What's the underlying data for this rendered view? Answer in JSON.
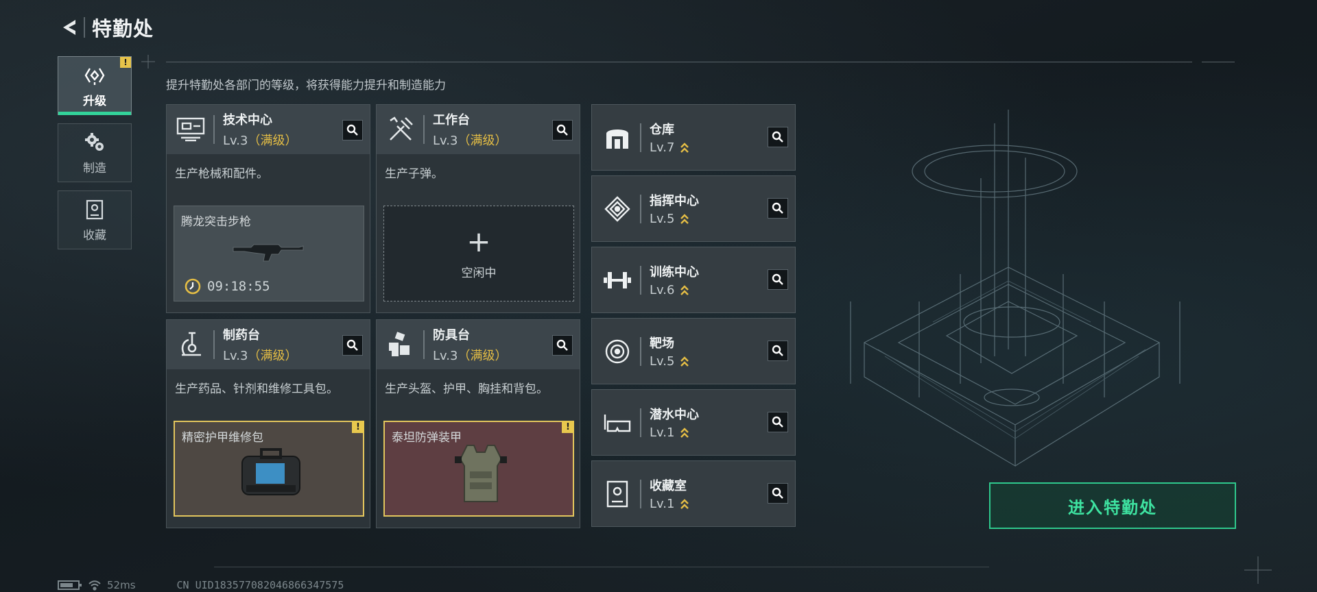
{
  "header": {
    "title": "特勤处"
  },
  "nav": [
    {
      "label": "升级",
      "icon": "upgrade-icon",
      "active": true,
      "badge": "!"
    },
    {
      "label": "制造",
      "icon": "gears-icon"
    },
    {
      "label": "收藏",
      "icon": "collection-icon"
    }
  ],
  "subtitle": "提升特勤处各部门的等级，将获得能力提升和制造能力",
  "big_cards": [
    {
      "name": "技术中心",
      "level": "Lv.3",
      "max": "（满级）",
      "icon": "tech-center-icon",
      "desc": "生产枪械和配件。",
      "slot": {
        "state": "crafting",
        "item": "腾龙突击步枪",
        "timer": "09:18:55",
        "icon": "rifle-icon"
      }
    },
    {
      "name": "工作台",
      "level": "Lv.3",
      "max": "（满级）",
      "icon": "workbench-icon",
      "desc": "生产子弹。",
      "slot": {
        "state": "empty",
        "label": "空闲中"
      }
    },
    {
      "name": "制药台",
      "level": "Lv.3",
      "max": "（满级）",
      "icon": "pharmacy-icon",
      "desc": "生产药品、针剂和维修工具包。",
      "slot": {
        "state": "done",
        "item": "精密护甲维修包",
        "badge": "!",
        "icon": "repair-kit-icon"
      }
    },
    {
      "name": "防具台",
      "level": "Lv.3",
      "max": "（满级）",
      "icon": "armor-bench-icon",
      "desc": "生产头盔、护甲、胸挂和背包。",
      "slot": {
        "state": "done",
        "item": "泰坦防弹装甲",
        "badge": "!",
        "icon": "body-armor-icon"
      }
    }
  ],
  "small_cards": [
    {
      "name": "仓库",
      "level": "Lv.7",
      "icon": "warehouse-icon"
    },
    {
      "name": "指挥中心",
      "level": "Lv.5",
      "icon": "command-center-icon"
    },
    {
      "name": "训练中心",
      "level": "Lv.6",
      "icon": "training-center-icon"
    },
    {
      "name": "靶场",
      "level": "Lv.5",
      "icon": "shooting-range-icon"
    },
    {
      "name": "潜水中心",
      "level": "Lv.1",
      "icon": "diving-center-icon"
    },
    {
      "name": "收藏室",
      "level": "Lv.1",
      "icon": "collection-room-icon"
    }
  ],
  "enter_button": "进入特勤处",
  "status": {
    "ping": "52ms",
    "uid": "CN UID183577082046866347575"
  },
  "colors": {
    "accent_green": "#33d39a",
    "max_gold": "#e5be45",
    "alert_yellow": "#e8c84e"
  }
}
